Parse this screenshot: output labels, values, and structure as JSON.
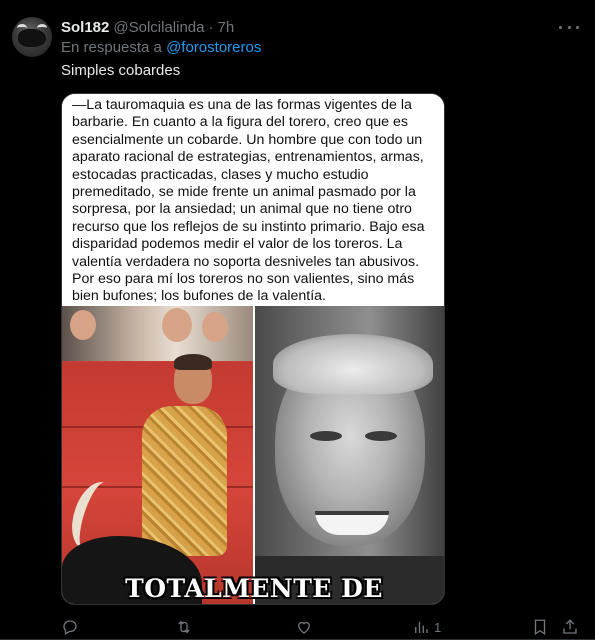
{
  "tweet": {
    "display_name": "Sol182",
    "handle": "@Solcilalinda",
    "separator": "·",
    "time": "7h",
    "reply_prefix": "En respuesta a",
    "reply_mention": "@forostoreros",
    "text": "Simples cobardes"
  },
  "media": {
    "quote_text": "—La tauromaquia es una de las formas vigentes de la barbarie. En cuanto a la figura del torero, creo que es esencialmente un cobarde. Un hombre que con todo un aparato racional de estrategias, entrenamientos, armas, estocadas practicadas, clases y mucho estudio premeditado, se mide frente un animal pasmado por la sorpresa, por la ansiedad; un animal que no tiene otro recurso que los reflejos de su instinto primario. Bajo esa disparidad podemos medir el valor de los toreros. La valentía verdadera no soporta desniveles tan abusivos. Por eso para mí los toreros no son valientes, sino más bien bufones; los bufones de la valentía.",
    "caption": "TOTALMENTE DE"
  },
  "actions": {
    "reply_icon": "reply-icon",
    "retweet_icon": "retweet-icon",
    "like_icon": "heart-icon",
    "views_icon": "views-chart-icon",
    "views_count": "1",
    "bookmark_icon": "bookmark-icon",
    "share_icon": "share-icon"
  },
  "colors": {
    "background": "#000000",
    "text_primary": "#e7e9ea",
    "text_secondary": "#71767b",
    "link": "#1d9bf0"
  }
}
